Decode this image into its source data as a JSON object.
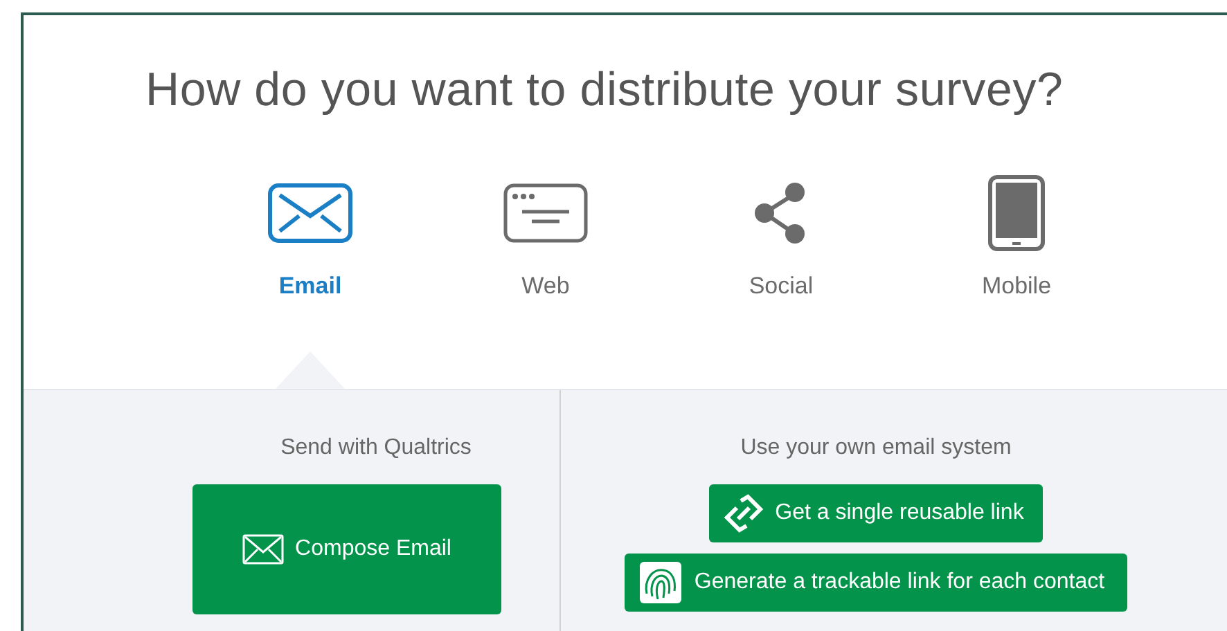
{
  "heading": "How do you want to distribute your survey?",
  "tabs": [
    {
      "label": "Email",
      "kind": "email",
      "selected": true
    },
    {
      "label": "Web",
      "kind": "web",
      "selected": false
    },
    {
      "label": "Social",
      "kind": "social",
      "selected": false
    },
    {
      "label": "Mobile",
      "kind": "mobile",
      "selected": false
    }
  ],
  "left_panel": {
    "title": "Send with Qualtrics",
    "button": "Compose Email"
  },
  "right_panel": {
    "title": "Use your own email system",
    "buttons": [
      {
        "label": "Get a single reusable link",
        "kind": "link"
      },
      {
        "label": "Generate a trackable link for each contact",
        "kind": "fingerprint"
      }
    ]
  }
}
